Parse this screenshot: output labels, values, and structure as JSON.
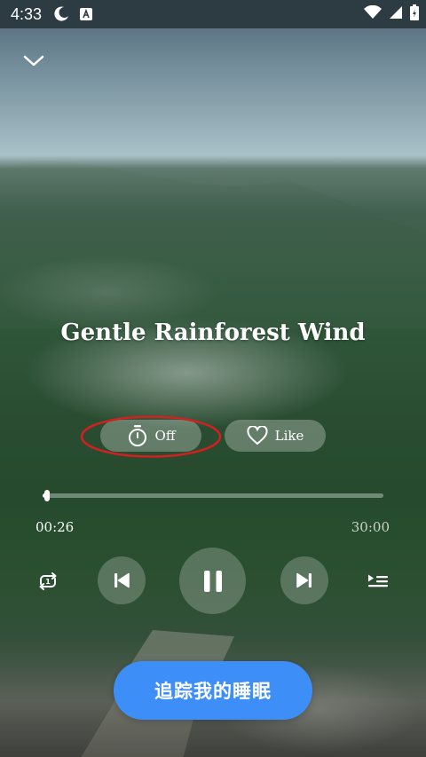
{
  "status_bar": {
    "time": "4:33",
    "icons": [
      "moon-icon",
      "a-badge-icon",
      "wifi-icon",
      "cell-signal-icon",
      "battery-icon"
    ]
  },
  "header": {
    "collapse_icon": "chevron-down-icon"
  },
  "track": {
    "title": "Gentle Rainforest Wind"
  },
  "actions": {
    "timer_label": "Off",
    "timer_icon": "stopwatch-icon",
    "like_label": "Like",
    "like_icon": "heart-outline-icon"
  },
  "playback": {
    "current_time": "00:26",
    "total_time": "30:00",
    "progress": 0.014,
    "state": "playing"
  },
  "controls": {
    "loop_icon": "repeat-once-icon",
    "prev_icon": "skip-previous-icon",
    "play_pause_icon": "pause-icon",
    "next_icon": "skip-next-icon",
    "playlist_icon": "playlist-icon"
  },
  "cta": {
    "label": "追踪我的睡眠",
    "color": "#3d8ef7"
  },
  "annotation": {
    "highlight_color": "#d0201f"
  }
}
